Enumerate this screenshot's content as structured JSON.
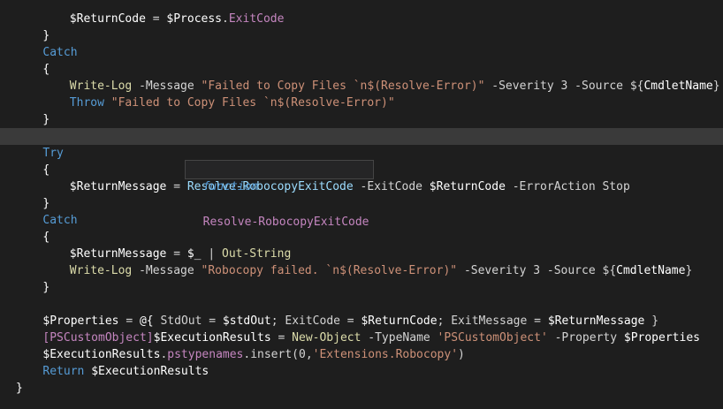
{
  "editor": {
    "current_line_index": 7,
    "lines": [
      {
        "indent": 8,
        "tokens": [
          {
            "t": "$",
            "c": "t-bright"
          },
          {
            "t": "ReturnCode",
            "c": "t-bright"
          },
          {
            "t": " = ",
            "c": "t-op"
          },
          {
            "t": "$",
            "c": "t-bright"
          },
          {
            "t": "Process",
            "c": "t-bright"
          },
          {
            "t": ".",
            "c": "t-op"
          },
          {
            "t": "ExitCode",
            "c": "t-prop"
          }
        ]
      },
      {
        "indent": 4,
        "tokens": [
          {
            "t": "}",
            "c": "t-bright"
          }
        ]
      },
      {
        "indent": 4,
        "tokens": [
          {
            "t": "Catch",
            "c": "t-kw"
          }
        ]
      },
      {
        "indent": 4,
        "tokens": [
          {
            "t": "{",
            "c": "t-bright"
          }
        ]
      },
      {
        "indent": 8,
        "tokens": [
          {
            "t": "Write-Log",
            "c": "t-cmd"
          },
          {
            "t": " -Message ",
            "c": "t-text"
          },
          {
            "t": "\"Failed to Copy Files `n$(Resolve-Error)\"",
            "c": "t-str"
          },
          {
            "t": " -Severity ",
            "c": "t-text"
          },
          {
            "t": "3",
            "c": "t-text"
          },
          {
            "t": " -Source ",
            "c": "t-text"
          },
          {
            "t": "${",
            "c": "t-op"
          },
          {
            "t": "CmdletName",
            "c": "t-bright"
          },
          {
            "t": "}",
            "c": "t-op"
          }
        ]
      },
      {
        "indent": 8,
        "tokens": [
          {
            "t": "Throw",
            "c": "t-kw"
          },
          {
            "t": " ",
            "c": "t-text"
          },
          {
            "t": "\"Failed to Copy Files `n$(Resolve-Error)\"",
            "c": "t-str"
          }
        ]
      },
      {
        "indent": 4,
        "tokens": [
          {
            "t": "}",
            "c": "t-bright"
          }
        ]
      },
      {
        "indent": 0,
        "tokens": []
      },
      {
        "indent": 4,
        "tokens": [
          {
            "t": "Try",
            "c": "t-kw"
          }
        ]
      },
      {
        "indent": 4,
        "tokens": [
          {
            "t": "{",
            "c": "t-bright"
          }
        ]
      },
      {
        "indent": 8,
        "tokens": [
          {
            "t": "$",
            "c": "t-bright"
          },
          {
            "t": "ReturnMessage",
            "c": "t-bright"
          },
          {
            "t": " = ",
            "c": "t-op"
          },
          {
            "t": "Resolve-RobocopyExitCode",
            "c": "t-var"
          },
          {
            "t": " -ExitCode ",
            "c": "t-text"
          },
          {
            "t": "$",
            "c": "t-bright"
          },
          {
            "t": "ReturnCode",
            "c": "t-bright"
          },
          {
            "t": " -ErrorAction ",
            "c": "t-text"
          },
          {
            "t": "Stop",
            "c": "t-text"
          }
        ]
      },
      {
        "indent": 4,
        "tokens": [
          {
            "t": "}",
            "c": "t-bright"
          }
        ]
      },
      {
        "indent": 4,
        "tokens": [
          {
            "t": "Catch",
            "c": "t-kw"
          }
        ]
      },
      {
        "indent": 4,
        "tokens": [
          {
            "t": "{",
            "c": "t-bright"
          }
        ]
      },
      {
        "indent": 8,
        "tokens": [
          {
            "t": "$",
            "c": "t-bright"
          },
          {
            "t": "ReturnMessage",
            "c": "t-bright"
          },
          {
            "t": " = ",
            "c": "t-op"
          },
          {
            "t": "$_",
            "c": "t-bright"
          },
          {
            "t": " | ",
            "c": "t-op"
          },
          {
            "t": "Out-String",
            "c": "t-cmd"
          }
        ]
      },
      {
        "indent": 8,
        "tokens": [
          {
            "t": "Write-Log",
            "c": "t-cmd"
          },
          {
            "t": " -Message ",
            "c": "t-text"
          },
          {
            "t": "\"Robocopy failed. `n$(Resolve-Error)\"",
            "c": "t-str"
          },
          {
            "t": " -Severity ",
            "c": "t-text"
          },
          {
            "t": "3",
            "c": "t-text"
          },
          {
            "t": " -Source ",
            "c": "t-text"
          },
          {
            "t": "${",
            "c": "t-op"
          },
          {
            "t": "CmdletName",
            "c": "t-bright"
          },
          {
            "t": "}",
            "c": "t-op"
          }
        ]
      },
      {
        "indent": 4,
        "tokens": [
          {
            "t": "}",
            "c": "t-bright"
          }
        ]
      },
      {
        "indent": 0,
        "tokens": []
      },
      {
        "indent": 4,
        "tokens": [
          {
            "t": "$",
            "c": "t-bright"
          },
          {
            "t": "Properties",
            "c": "t-bright"
          },
          {
            "t": " = ",
            "c": "t-op"
          },
          {
            "t": "@{",
            "c": "t-bright"
          },
          {
            "t": " StdOut = ",
            "c": "t-text"
          },
          {
            "t": "$",
            "c": "t-bright"
          },
          {
            "t": "stdOut",
            "c": "t-bright"
          },
          {
            "t": "; ExitCode = ",
            "c": "t-text"
          },
          {
            "t": "$",
            "c": "t-bright"
          },
          {
            "t": "ReturnCode",
            "c": "t-bright"
          },
          {
            "t": "; ExitMessage = ",
            "c": "t-text"
          },
          {
            "t": "$",
            "c": "t-bright"
          },
          {
            "t": "ReturnMessage",
            "c": "t-bright"
          },
          {
            "t": " }",
            "c": "t-text"
          }
        ]
      },
      {
        "indent": 4,
        "tokens": [
          {
            "t": "[PSCustomObject]",
            "c": "t-prop"
          },
          {
            "t": "$",
            "c": "t-bright"
          },
          {
            "t": "ExecutionResults",
            "c": "t-bright"
          },
          {
            "t": " = ",
            "c": "t-op"
          },
          {
            "t": "New-Object",
            "c": "t-cmd"
          },
          {
            "t": " -TypeName ",
            "c": "t-text"
          },
          {
            "t": "'PSCustomObject'",
            "c": "t-str"
          },
          {
            "t": " -Property ",
            "c": "t-text"
          },
          {
            "t": "$",
            "c": "t-bright"
          },
          {
            "t": "Properties",
            "c": "t-bright"
          }
        ]
      },
      {
        "indent": 4,
        "tokens": [
          {
            "t": "$",
            "c": "t-bright"
          },
          {
            "t": "ExecutionResults",
            "c": "t-bright"
          },
          {
            "t": ".",
            "c": "t-op"
          },
          {
            "t": "pstypenames",
            "c": "t-prop"
          },
          {
            "t": ".insert(",
            "c": "t-text"
          },
          {
            "t": "0",
            "c": "t-text"
          },
          {
            "t": ",",
            "c": "t-text"
          },
          {
            "t": "'Extensions.Robocopy'",
            "c": "t-str"
          },
          {
            "t": ")",
            "c": "t-text"
          }
        ]
      },
      {
        "indent": 4,
        "tokens": [
          {
            "t": "Return",
            "c": "t-kw"
          },
          {
            "t": " ",
            "c": "t-text"
          },
          {
            "t": "$",
            "c": "t-bright"
          },
          {
            "t": "ExecutionResults",
            "c": "t-bright"
          }
        ]
      },
      {
        "indent": 0,
        "tokens": [
          {
            "t": "}",
            "c": "t-bright"
          }
        ]
      }
    ]
  },
  "hover_tooltip": {
    "keyword": "function",
    "name": "Resolve-RobocopyExitCode"
  },
  "colors": {
    "background": "#1e1e1e",
    "current_line": "#3a3a3a",
    "keyword": "#569cd6",
    "command": "#dcdcaa",
    "string": "#ce9178",
    "property": "#c586c0",
    "variable": "#ffffff"
  }
}
